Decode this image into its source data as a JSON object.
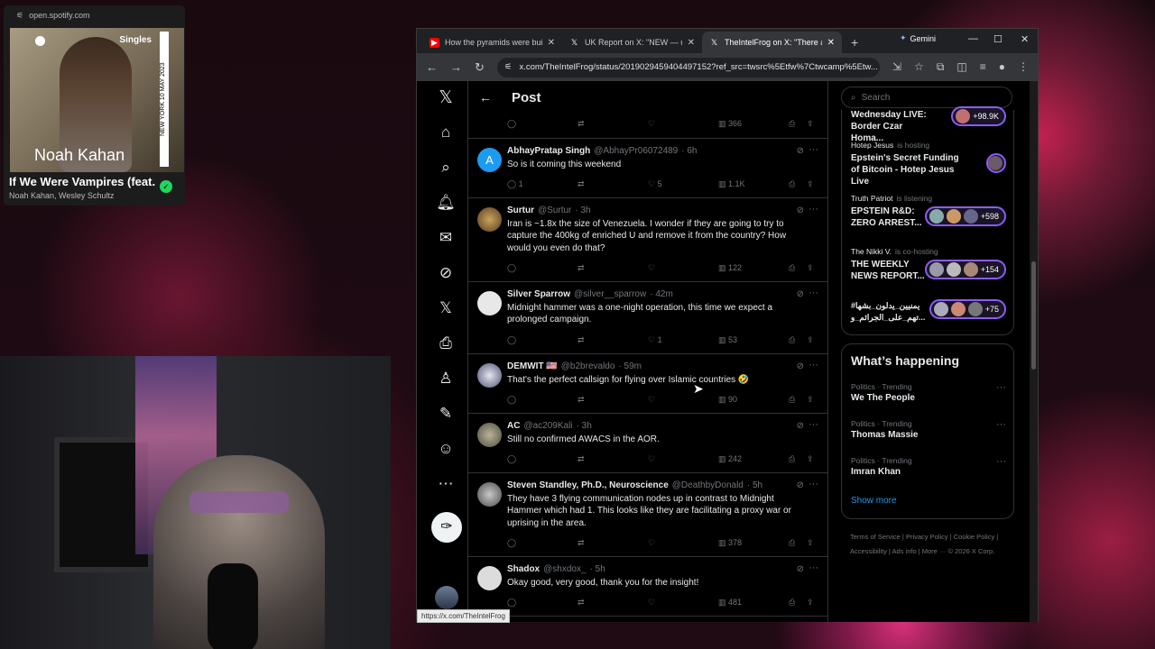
{
  "spotify": {
    "url": "open.spotify.com",
    "badge": "Singles",
    "artist_overlay": "Noah Kahan",
    "vertical_text": "NEW YORK  10 MAY  2023",
    "track": "If We Were Vampires (feat. Wesley Schultz)",
    "artists": "Noah Kahan, Wesley Schultz"
  },
  "tabs": [
    {
      "title": "How the pyramids were built",
      "color": "#ff0000",
      "icon": "▶"
    },
    {
      "title": "UK Report on X: \"NEW — usa",
      "color": "#000000",
      "icon": "𝕏"
    },
    {
      "title": "TheIntelFrog on X: \"There are",
      "color": "#000000",
      "icon": "𝕏"
    }
  ],
  "gemini": "Gemini",
  "address": "x.com/TheIntelFrog/status/2019029459404497152?ref_src=twsrc%5Etfw%7Ctwcamp%5Etw...",
  "header": {
    "title": "Post"
  },
  "search": {
    "placeholder": "Search"
  },
  "top_actions": {
    "views": "366"
  },
  "tweets": [
    {
      "name": "AbhayPratap Singh",
      "handle": "@AbhayPr06072489",
      "time": "· 6h",
      "text": "So is it coming this weekend",
      "replies": "1",
      "likes": "5",
      "views": "1.1K",
      "avatar": "#1d9bf0",
      "initial": "A"
    },
    {
      "name": "Surtur",
      "handle": "@Surtur",
      "time": "· 3h",
      "text": "Iran is ~1.8x the size of Venezuela.  I wonder if they are going to try to capture the 400kg of enriched U and remove it from the country?  How would you even do that?",
      "replies": "",
      "likes": "",
      "views": "122",
      "avatar": "#8a6b3d",
      "initial": ""
    },
    {
      "name": "Silver Sparrow",
      "handle": "@silver__sparrow",
      "time": "· 42m",
      "text": "Midnight hammer was a one-night operation, this time we expect a prolonged campaign.",
      "replies": "",
      "likes": "1",
      "views": "53",
      "avatar": "#e8e8e8",
      "initial": ""
    },
    {
      "name": "DEMWIT 🇺🇸",
      "handle": "@b2brevaldo",
      "time": "· 59m",
      "text": "That's the perfect callsign for flying over Islamic countries 🤣",
      "replies": "",
      "likes": "",
      "views": "90",
      "avatar": "#7a7f9a",
      "initial": ""
    },
    {
      "name": "AC",
      "handle": "@ac209Kali",
      "time": "· 3h",
      "text": "Still no confirmed AWACS in the AOR.",
      "replies": "",
      "likes": "",
      "views": "242",
      "avatar": "#6b6b55",
      "initial": ""
    },
    {
      "name": "Steven Standley, Ph.D., Neuroscience",
      "handle": "@DeathbyDonald",
      "time": "· 5h",
      "text": "They have 3 flying communication nodes up in contrast to Midnight Hammer which had 1. This looks like they are facilitating a proxy war or uprising in the area.",
      "replies": "",
      "likes": "",
      "views": "378",
      "avatar": "#8d8d8d",
      "initial": ""
    },
    {
      "name": "Shadox",
      "handle": "@shxdox_",
      "time": "· 5h",
      "text": "Okay good, very good, thank you for the insight!",
      "replies": "",
      "likes": "",
      "views": "481",
      "avatar": "#dcdcdc",
      "initial": ""
    }
  ],
  "spaces": [
    {
      "host": "",
      "status": "",
      "title": "Wednesday LIVE: Border Czar Homa...",
      "count": "+98.9K"
    },
    {
      "host": "Hotep Jesus",
      "status": "is hosting",
      "title": "Epstein's Secret Funding of Bitcoin - Hotep Jesus Live",
      "count": ""
    },
    {
      "host": "Truth Patriot",
      "status": "is listening",
      "title": "EPSTEIN R&D: ZERO ARREST...",
      "count": "+598"
    },
    {
      "host": "The Nikki V.",
      "status": "is co-hosting",
      "title": "THE WEEKLY NEWS REPORT...",
      "count": "+154"
    },
    {
      "host": "",
      "status": "",
      "title": "#يمنيين_يدلون_بشها تهم_على_الجرائم_و...",
      "count": "+75"
    }
  ],
  "happening": {
    "title": "What’s happening",
    "trends": [
      {
        "cat": "Politics · Trending",
        "name": "We The People"
      },
      {
        "cat": "Politics · Trending",
        "name": "Thomas Massie"
      },
      {
        "cat": "Politics · Trending",
        "name": "Imran Khan"
      }
    ],
    "show_more": "Show more"
  },
  "footer": {
    "links": "Terms of Service  |  Privacy Policy  |  Cookie Policy  |  Accessibility  |  Ads info  |  More ···   © 2026 X Corp."
  },
  "status_url": "https://x.com/TheIntelFrog"
}
